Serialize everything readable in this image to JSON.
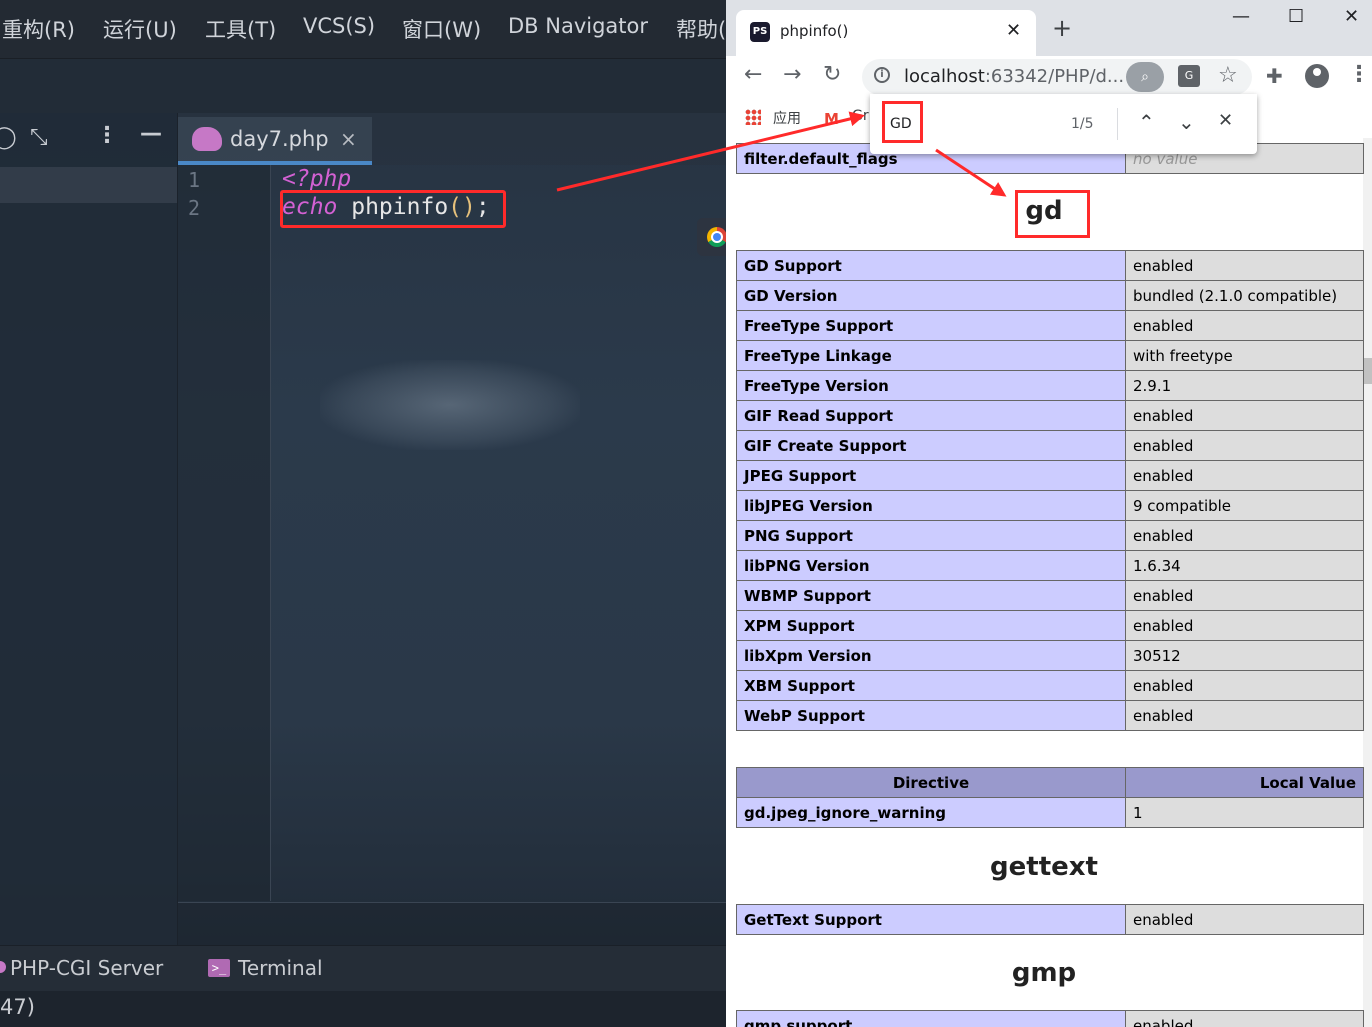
{
  "ide": {
    "menu": [
      "重构(R)",
      "运行(U)",
      "工具(T)",
      "VCS(S)",
      "窗口(W)",
      "DB Navigator",
      "帮助("
    ],
    "editor_tab": {
      "label": "day7.php",
      "close": "×"
    },
    "line_numbers": [
      "1",
      "2"
    ],
    "code": {
      "line1": "<?php",
      "echo": "echo",
      "fn": " phpinfo",
      "parens": "()",
      "semi": ";"
    },
    "bottom_tabs": {
      "phpcgi": "PHP-CGI Server",
      "terminal": "Terminal"
    },
    "status_text": "47)"
  },
  "browser": {
    "tab_title": "phpinfo()",
    "tab_close": "✕",
    "new_tab": "+",
    "window_controls": {
      "minimize": "—",
      "maximize": "☐",
      "close": "✕"
    },
    "url": {
      "host": "localhost",
      "rest": ":63342/PHP/d..."
    },
    "bookmarks": {
      "apps": "应用",
      "gmail": "Gr"
    },
    "find": {
      "query": "GD",
      "count": "1/5",
      "prev": "⌃",
      "next": "⌄",
      "close": "✕"
    },
    "top_partial_row": {
      "key": "filter.default_flags",
      "value": "no value"
    },
    "section_gd": "gd",
    "gd_rows": [
      {
        "key": "GD Support",
        "value": "enabled"
      },
      {
        "key": "GD Version",
        "value": "bundled (2.1.0 compatible)"
      },
      {
        "key": "FreeType Support",
        "value": "enabled"
      },
      {
        "key": "FreeType Linkage",
        "value": "with freetype"
      },
      {
        "key": "FreeType Version",
        "value": "2.9.1"
      },
      {
        "key": "GIF Read Support",
        "value": "enabled"
      },
      {
        "key": "GIF Create Support",
        "value": "enabled"
      },
      {
        "key": "JPEG Support",
        "value": "enabled"
      },
      {
        "key": "libJPEG Version",
        "value": "9 compatible"
      },
      {
        "key": "PNG Support",
        "value": "enabled"
      },
      {
        "key": "libPNG Version",
        "value": "1.6.34"
      },
      {
        "key": "WBMP Support",
        "value": "enabled"
      },
      {
        "key": "XPM Support",
        "value": "enabled"
      },
      {
        "key": "libXpm Version",
        "value": "30512"
      },
      {
        "key": "XBM Support",
        "value": "enabled"
      },
      {
        "key": "WebP Support",
        "value": "enabled"
      }
    ],
    "directive_header": {
      "directive": "Directive",
      "local": "Local Value"
    },
    "directive_row": {
      "key": "gd.jpeg_ignore_warning",
      "value": "1"
    },
    "section_gettext": "gettext",
    "gettext_row": {
      "key": "GetText Support",
      "value": "enabled"
    },
    "section_gmp": "gmp",
    "gmp_row": {
      "key": "gmp support",
      "value": "enabled"
    }
  },
  "colors": {
    "annotation_red": "#ff2a2a",
    "phpinfo_key_bg": "#ccccff",
    "phpinfo_value_bg": "#dddddd",
    "phpinfo_header_bg": "#9999cc"
  }
}
